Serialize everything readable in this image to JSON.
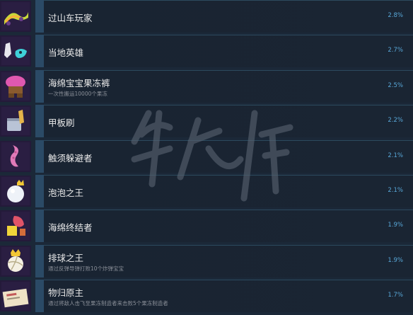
{
  "achievements": [
    {
      "name": "过山车玩家",
      "desc": "",
      "percent": "2.8%",
      "icon": "rollercoaster-icon"
    },
    {
      "name": "当地英雄",
      "desc": "",
      "percent": "2.7%",
      "icon": "sock-puppets-icon"
    },
    {
      "name": "海绵宝宝果冻裤",
      "desc": "一次性搬运10000个果冻",
      "percent": "2.5%",
      "icon": "jelly-pants-icon"
    },
    {
      "name": "甲板刷",
      "desc": "",
      "percent": "2.2%",
      "icon": "deck-brush-icon"
    },
    {
      "name": "触须躲避者",
      "desc": "",
      "percent": "2.1%",
      "icon": "tentacle-icon"
    },
    {
      "name": "泡泡之王",
      "desc": "",
      "percent": "2.1%",
      "icon": "bubble-king-icon"
    },
    {
      "name": "海绵终结者",
      "desc": "",
      "percent": "1.9%",
      "icon": "sponge-terminator-icon"
    },
    {
      "name": "排球之王",
      "desc": "通过反弹导弹打败10个炸弹宝宝",
      "percent": "1.9%",
      "icon": "volleyball-king-icon"
    },
    {
      "name": "物归原主",
      "desc": "通过将敌人击飞至果冻制造者来击败5个果冻制造者",
      "percent": "1.7%",
      "icon": "return-letter-icon"
    }
  ],
  "colors": {
    "background": "#1b2838",
    "accent": "#58a7d8",
    "bar": "#2b4a66"
  }
}
